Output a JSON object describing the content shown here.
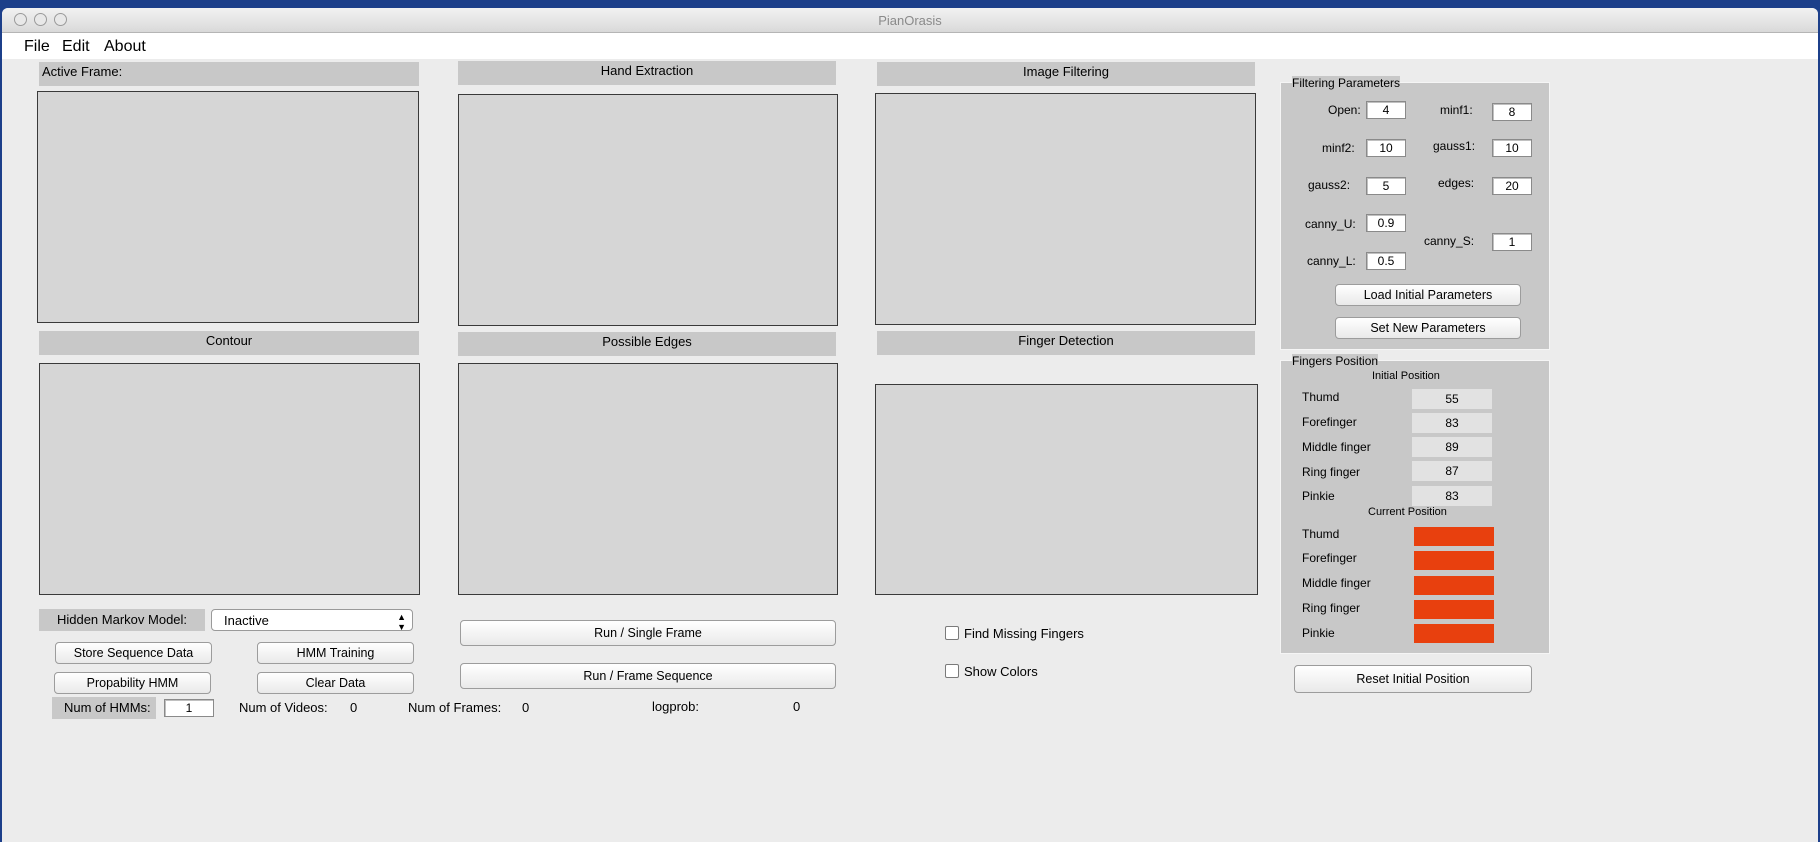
{
  "window": {
    "title": "PianOrasis"
  },
  "menu": [
    "File",
    "Edit",
    "About"
  ],
  "panels": {
    "active_frame": "Active Frame:",
    "hand_extraction": "Hand Extraction",
    "image_filtering": "Image Filtering",
    "contour": "Contour",
    "possible_edges": "Possible Edges",
    "finger_detection": "Finger Detection"
  },
  "filtering": {
    "title": "Filtering Parameters",
    "open_label": "Open:",
    "open_value": "4",
    "minf1_label": "minf1:",
    "minf1_value": "8",
    "minf2_label": "minf2:",
    "minf2_value": "10",
    "gauss1_label": "gauss1:",
    "gauss1_value": "10",
    "gauss2_label": "gauss2:",
    "gauss2_value": "5",
    "edges_label": "edges:",
    "edges_value": "20",
    "cannyU_label": "canny_U:",
    "cannyU_value": "0.9",
    "cannyS_label": "canny_S:",
    "cannyS_value": "1",
    "cannyL_label": "canny_L:",
    "cannyL_value": "0.5",
    "load_button": "Load Initial Parameters",
    "set_button": "Set New Parameters"
  },
  "fingers": {
    "title": "Fingers Position",
    "initial_title": "Initial Position",
    "current_title": "Current Position",
    "initial": [
      {
        "name": "Thumd",
        "value": "55"
      },
      {
        "name": "Forefinger",
        "value": "83"
      },
      {
        "name": "Middle finger",
        "value": "89"
      },
      {
        "name": "Ring finger",
        "value": "87"
      },
      {
        "name": "Pinkie",
        "value": "83"
      }
    ],
    "current": [
      {
        "name": "Thumd"
      },
      {
        "name": "Forefinger"
      },
      {
        "name": "Middle finger"
      },
      {
        "name": "Ring finger"
      },
      {
        "name": "Pinkie"
      }
    ],
    "current_color": "#e8400e",
    "reset_button": "Reset Initial Position"
  },
  "hmm": {
    "label": "Hidden Markov Model:",
    "selected": "Inactive",
    "store_button": "Store Sequence Data",
    "training_button": "HMM Training",
    "probability_button": "Propability HMM",
    "clear_button": "Clear Data"
  },
  "run": {
    "single_button": "Run / Single Frame",
    "sequence_button": "Run / Frame Sequence"
  },
  "options": {
    "find_missing": "Find Missing Fingers",
    "show_colors": "Show Colors"
  },
  "status": {
    "num_hmms_label": "Num of HMMs:",
    "num_hmms_value": "1",
    "num_videos_label": "Num of Videos:",
    "num_videos_value": "0",
    "num_frames_label": "Num of Frames:",
    "num_frames_value": "0",
    "logprob_label": "logprob:",
    "logprob_value": "0"
  }
}
